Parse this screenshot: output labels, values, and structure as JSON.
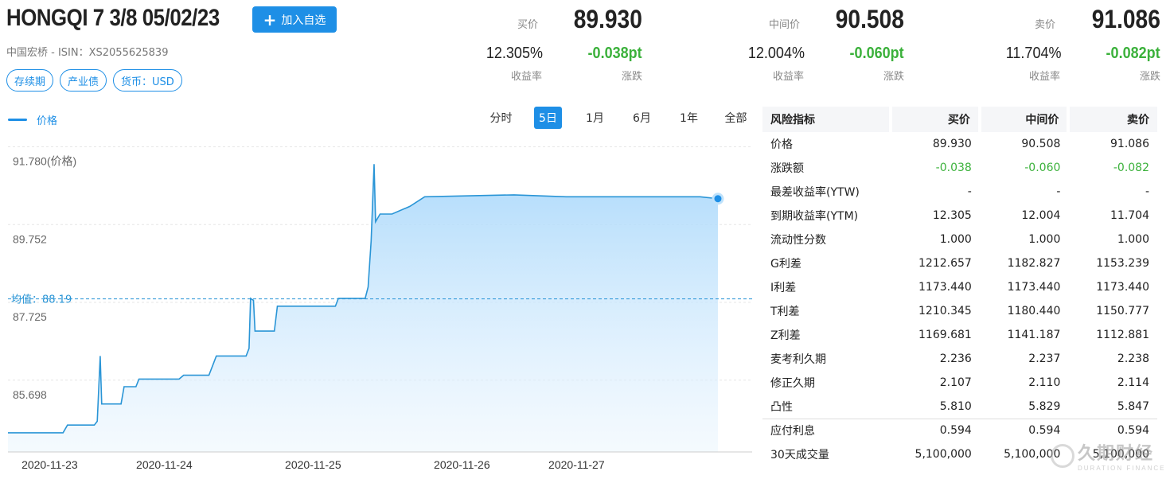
{
  "header": {
    "title": "HONGQI 7 3/8 05/02/23",
    "add_watch_label": "加入自选",
    "issuer_line": "中国宏桥 - ISIN：XS2055625839",
    "tags": [
      "存续期",
      "产业债",
      "货币：USD"
    ]
  },
  "quotes": [
    {
      "label": "买价",
      "price": "89.930",
      "yield": "12.305%",
      "yield_label": "收益率",
      "change": "-0.038pt",
      "change_label": "涨跌"
    },
    {
      "label": "中间价",
      "price": "90.508",
      "yield": "12.004%",
      "yield_label": "收益率",
      "change": "-0.060pt",
      "change_label": "涨跌"
    },
    {
      "label": "卖价",
      "price": "91.086",
      "yield": "11.704%",
      "yield_label": "收益率",
      "change": "-0.082pt",
      "change_label": "涨跌"
    }
  ],
  "chart_controls": {
    "legend_label": "价格",
    "ranges": [
      "分时",
      "5日",
      "1月",
      "6月",
      "1年",
      "全部"
    ],
    "active_range": "5日"
  },
  "chart_data": {
    "type": "area",
    "series": [
      {
        "name": "价格"
      }
    ],
    "y_axis_labels": [
      "91.780(价格)",
      "89.752",
      "87.725",
      "85.698"
    ],
    "y_ticks": [
      91.78,
      89.752,
      87.725,
      85.698
    ],
    "ylim": [
      84.2,
      92.35
    ],
    "xlim": [
      0,
      5
    ],
    "x_tick_labels": [
      "2020-11-23",
      "2020-11-24",
      "2020-11-25",
      "2020-11-26",
      "2020-11-27"
    ],
    "x_tick_positions": [
      0.28,
      1.05,
      2.05,
      3.05,
      3.82
    ],
    "average_label": "均值：88.19",
    "average": 88.19,
    "points": [
      [
        0.0,
        84.7
      ],
      [
        0.37,
        84.7
      ],
      [
        0.4,
        84.9
      ],
      [
        0.58,
        84.9
      ],
      [
        0.6,
        85.0
      ],
      [
        0.62,
        86.7
      ],
      [
        0.63,
        85.45
      ],
      [
        0.76,
        85.45
      ],
      [
        0.78,
        85.9
      ],
      [
        0.86,
        85.9
      ],
      [
        0.88,
        86.1
      ],
      [
        1.15,
        86.1
      ],
      [
        1.18,
        86.2
      ],
      [
        1.35,
        86.2
      ],
      [
        1.38,
        86.5
      ],
      [
        1.4,
        86.7
      ],
      [
        1.6,
        86.7
      ],
      [
        1.62,
        86.9
      ],
      [
        1.63,
        88.2
      ],
      [
        1.65,
        88.15
      ],
      [
        1.66,
        87.35
      ],
      [
        1.79,
        87.35
      ],
      [
        1.81,
        88.0
      ],
      [
        2.2,
        88.0
      ],
      [
        2.22,
        88.2
      ],
      [
        2.4,
        88.2
      ],
      [
        2.42,
        88.5
      ],
      [
        2.44,
        89.7
      ],
      [
        2.46,
        91.7
      ],
      [
        2.47,
        90.2
      ],
      [
        2.5,
        90.4
      ],
      [
        2.58,
        90.4
      ],
      [
        2.7,
        90.6
      ],
      [
        2.8,
        90.85
      ],
      [
        3.4,
        90.9
      ],
      [
        3.75,
        90.85
      ],
      [
        4.65,
        90.85
      ],
      [
        4.77,
        90.8
      ]
    ]
  },
  "risk_table": {
    "headers": [
      "风险指标",
      "买价",
      "中间价",
      "卖价"
    ],
    "rows": [
      {
        "name": "价格",
        "bid": "89.930",
        "mid": "90.508",
        "ask": "91.086"
      },
      {
        "name": "涨跌额",
        "bid": "-0.038",
        "mid": "-0.060",
        "ask": "-0.082",
        "green": true
      },
      {
        "name": "最差收益率(YTW)",
        "bid": "-",
        "mid": "-",
        "ask": "-"
      },
      {
        "name": "到期收益率(YTM)",
        "bid": "12.305",
        "mid": "12.004",
        "ask": "11.704"
      },
      {
        "name": "流动性分数",
        "bid": "1.000",
        "mid": "1.000",
        "ask": "1.000"
      },
      {
        "name": "G利差",
        "bid": "1212.657",
        "mid": "1182.827",
        "ask": "1153.239"
      },
      {
        "name": "I利差",
        "bid": "1173.440",
        "mid": "1173.440",
        "ask": "1173.440"
      },
      {
        "name": "T利差",
        "bid": "1210.345",
        "mid": "1180.440",
        "ask": "1150.777"
      },
      {
        "name": "Z利差",
        "bid": "1169.681",
        "mid": "1141.187",
        "ask": "1112.881"
      },
      {
        "name": "麦考利久期",
        "bid": "2.236",
        "mid": "2.237",
        "ask": "2.238"
      },
      {
        "name": "修正久期",
        "bid": "2.107",
        "mid": "2.110",
        "ask": "2.114"
      },
      {
        "name": "凸性",
        "bid": "5.810",
        "mid": "5.829",
        "ask": "5.847"
      },
      {
        "name": "应付利息",
        "bid": "0.594",
        "mid": "0.594",
        "ask": "0.594",
        "sep": true
      },
      {
        "name": "30天成交量",
        "bid": "5,100,000",
        "mid": "5,100,000",
        "ask": "5,100,000"
      }
    ]
  },
  "watermark": {
    "cn": "久期财经",
    "en": "DURATION FINANCE"
  },
  "colors": {
    "accent": "#1e8fe6",
    "down": "#3bb13b",
    "line": "#2a95d6"
  }
}
